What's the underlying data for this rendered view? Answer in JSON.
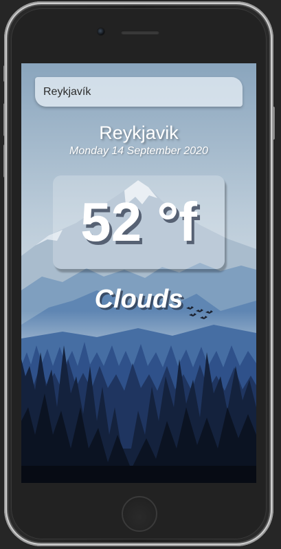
{
  "search": {
    "value": "Reykjavík",
    "placeholder": ""
  },
  "weather": {
    "location": "Reykjavik",
    "date": "Monday 14 September 2020",
    "temperature": "52 °f",
    "condition": "Clouds"
  },
  "icons": {
    "camera": "front-camera-icon",
    "speaker": "earpiece-speaker-icon",
    "home": "home-button",
    "birds": "birds-icon"
  },
  "colors": {
    "sky_top": "#8fa9c0",
    "sky_bottom": "#cdd9e2",
    "mountain_far": "#9cb3c8",
    "mountain_mid": "#5f88b5",
    "forest_back": "#2c4c85",
    "forest_front": "#0f1a2c"
  }
}
